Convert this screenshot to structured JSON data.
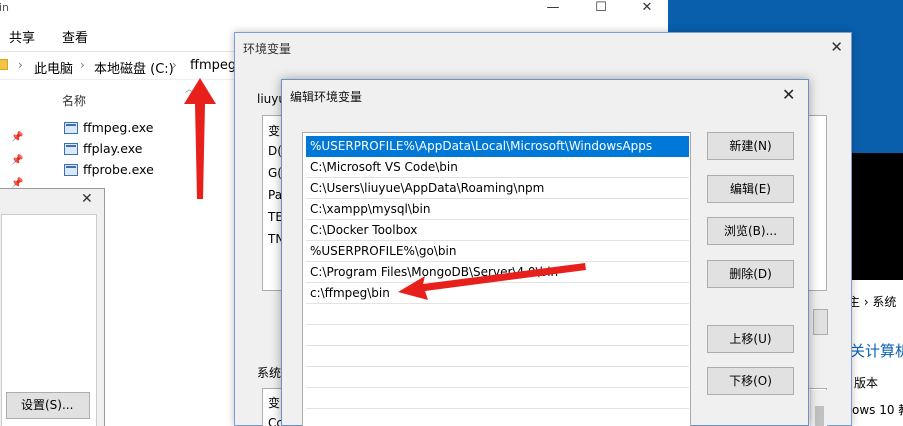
{
  "explorer": {
    "title": "bin",
    "ribbon_tabs": [
      "共享",
      "查看"
    ],
    "breadcrumb": [
      "此电脑",
      "本地磁盘 (C:)",
      "ffmpeg"
    ],
    "column_name": "名称",
    "files": [
      "ffmpeg.exe",
      "ffplay.exe",
      "ffprobe.exe"
    ],
    "window_controls": [
      "—",
      "☐",
      "✕"
    ]
  },
  "left_dialog": {
    "settings_button": "设置(S)..."
  },
  "background_panel": {
    "nav_text": "主 › 系统",
    "about_title": "关计算机",
    "version_label": "版本",
    "windows_text": "ows 10 教"
  },
  "env_dialog": {
    "title": "环境变量",
    "user_group_label": "liuyu",
    "user_rows": [
      "变",
      "D(",
      "G(",
      "Pa",
      "TE",
      "TN"
    ],
    "system_group_label": "系统",
    "system_rows": [
      "变",
      "Cc"
    ]
  },
  "edit_dialog": {
    "title": "编辑环境变量",
    "paths": [
      "%USERPROFILE%\\AppData\\Local\\Microsoft\\WindowsApps",
      "C:\\Microsoft VS Code\\bin",
      "C:\\Users\\liuyue\\AppData\\Roaming\\npm",
      "C:\\xampp\\mysql\\bin",
      "C:\\Docker Toolbox",
      "%USERPROFILE%\\go\\bin",
      "C:\\Program Files\\MongoDB\\Server\\4.0\\bin",
      "c:\\ffmpeg\\bin"
    ],
    "selected_index": 0,
    "buttons": {
      "new": "新建(N)",
      "edit": "编辑(E)",
      "browse": "浏览(B)...",
      "delete": "删除(D)",
      "move_up": "上移(U)",
      "move_down": "下移(O)"
    }
  },
  "annotation_color": "#e8201c"
}
